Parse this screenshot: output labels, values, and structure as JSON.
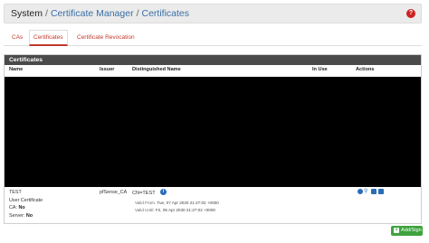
{
  "breadcrumb": {
    "system": "System",
    "separator": "/",
    "certificate_manager": "Certificate Manager",
    "certificates": "Certificates"
  },
  "help_icon": "?",
  "tabs": [
    {
      "label": "CAs",
      "active": false
    },
    {
      "label": "Certificates",
      "active": true
    },
    {
      "label": "Certificate Revocation",
      "active": false
    }
  ],
  "panel": {
    "title": "Certificates",
    "columns": {
      "name": "Name",
      "issuer": "Issuer",
      "dn": "Distinguished Name",
      "in_use": "In Use",
      "actions": "Actions"
    }
  },
  "row": {
    "name": "TEST",
    "type": "User Certificate",
    "ca_label": "CA:",
    "ca_value": "No",
    "server_label": "Server:",
    "server_value": "No",
    "issuer": "pfSense_CA",
    "dn": "CN=TEST",
    "valid_from_label": "Valid From:",
    "valid_from": "Tue, 07 Apr 2020 21:27:02 +0000",
    "valid_until_label": "Valid Until:",
    "valid_until": "Fri, 05 Apr 2030 21:27:02 +0000",
    "in_use": ""
  },
  "add_button": {
    "label": "Add/Sign",
    "icon": "plus-icon"
  },
  "colors": {
    "accent_red": "#c0392b",
    "link_blue": "#3a6fa8",
    "action_blue": "#2a6db4",
    "add_green": "#3ea33e"
  }
}
